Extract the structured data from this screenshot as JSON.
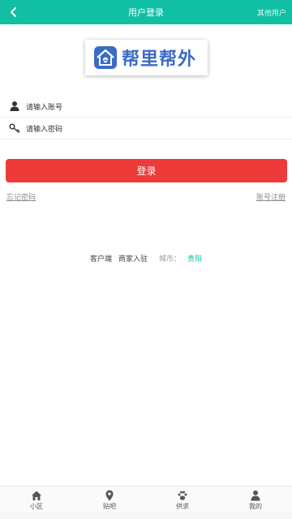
{
  "colors": {
    "header_bg": "#11bfa4",
    "login_button": "#ef3a3a",
    "city_link": "#11bfa4",
    "logo_blue": "#3a6bc6"
  },
  "header": {
    "title": "用户登录",
    "back_icon": "chevron-left-icon",
    "other_users": "其他用户"
  },
  "logo": {
    "text": "帮里帮外",
    "icon": "house-handshake-icon"
  },
  "form": {
    "account_placeholder": "请输入账号",
    "account_icon": "user-icon",
    "password_placeholder": "请输入密码",
    "password_icon": "key-icon",
    "login_label": "登录",
    "forgot_password": "忘记密码",
    "register": "账号注册"
  },
  "footer_links": {
    "client": "客户端",
    "merchant": "商家入驻",
    "city_label": "城市：",
    "city": "贵阳"
  },
  "tabbar": {
    "items": [
      {
        "label": "小区",
        "icon": "home-icon"
      },
      {
        "label": "贴吧",
        "icon": "location-pin-icon"
      },
      {
        "label": "供求",
        "icon": "paw-icon"
      },
      {
        "label": "我的",
        "icon": "person-icon"
      }
    ]
  }
}
